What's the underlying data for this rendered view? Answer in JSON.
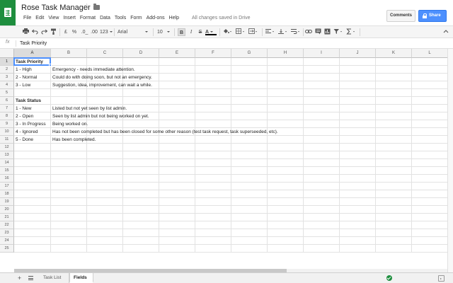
{
  "app": {
    "title": "Rose Task Manager",
    "save_status": "All changes saved in Drive",
    "menu": [
      "File",
      "Edit",
      "View",
      "Insert",
      "Format",
      "Data",
      "Tools",
      "Form",
      "Add-ons",
      "Help"
    ],
    "comments_label": "Comments",
    "share_label": "Share",
    "accent_color": "#1e8e3e",
    "share_color": "#4d90fe"
  },
  "toolbar": {
    "currency": "£",
    "percent": "%",
    "dec_decrease": ".0_",
    ".00": ".00",
    "more_formats": "123",
    "font": "Arial",
    "font_size": "10",
    "bold": "B",
    "italic": "I",
    "strike": "S",
    "text_color": "A"
  },
  "formula": {
    "fx": "fx",
    "value": "Task Priority"
  },
  "grid": {
    "columns": [
      "A",
      "B",
      "C",
      "D",
      "E",
      "F",
      "G",
      "H",
      "I",
      "J",
      "K",
      "L"
    ],
    "rows": [
      "1",
      "2",
      "3",
      "4",
      "5",
      "6",
      "7",
      "8",
      "9",
      "10",
      "11",
      "12",
      "13",
      "14",
      "15",
      "16",
      "17",
      "18",
      "19",
      "20",
      "21",
      "22",
      "23",
      "24",
      "25"
    ],
    "selected_col": "A",
    "selected_row": "1",
    "cells": [
      {
        "row": 1,
        "col": "A",
        "text": "Task Priority",
        "bold": true
      },
      {
        "row": 2,
        "col": "A",
        "text": "1 - High"
      },
      {
        "row": 2,
        "col": "B",
        "text": "Emergency - needs immediate attention."
      },
      {
        "row": 3,
        "col": "A",
        "text": "2 - Normal"
      },
      {
        "row": 3,
        "col": "B",
        "text": "Could do with doing soon, but not an emergency."
      },
      {
        "row": 4,
        "col": "A",
        "text": "3 - Low"
      },
      {
        "row": 4,
        "col": "B",
        "text": "Suggestion, idea, improvement, can wait a while."
      },
      {
        "row": 6,
        "col": "A",
        "text": "Task Status",
        "bold": true
      },
      {
        "row": 7,
        "col": "A",
        "text": "1 - New"
      },
      {
        "row": 7,
        "col": "B",
        "text": "Listed but not yet seen by list admin."
      },
      {
        "row": 8,
        "col": "A",
        "text": "2 - Open"
      },
      {
        "row": 8,
        "col": "B",
        "text": "Seen by list admin but not being worked on yet."
      },
      {
        "row": 9,
        "col": "A",
        "text": "3 - In Progress"
      },
      {
        "row": 9,
        "col": "B",
        "text": "Being worked on."
      },
      {
        "row": 10,
        "col": "A",
        "text": "4 - Ignored"
      },
      {
        "row": 10,
        "col": "B",
        "text": "Has not been completed but has been closed for some other reason (test task request, task superseeded, etc)."
      },
      {
        "row": 11,
        "col": "A",
        "text": "5 - Done"
      },
      {
        "row": 11,
        "col": "B",
        "text": "Has been completed."
      }
    ]
  },
  "sheets": {
    "add": "+",
    "tabs": [
      {
        "label": "Task List",
        "active": false
      },
      {
        "label": "Fields",
        "active": true
      }
    ]
  }
}
